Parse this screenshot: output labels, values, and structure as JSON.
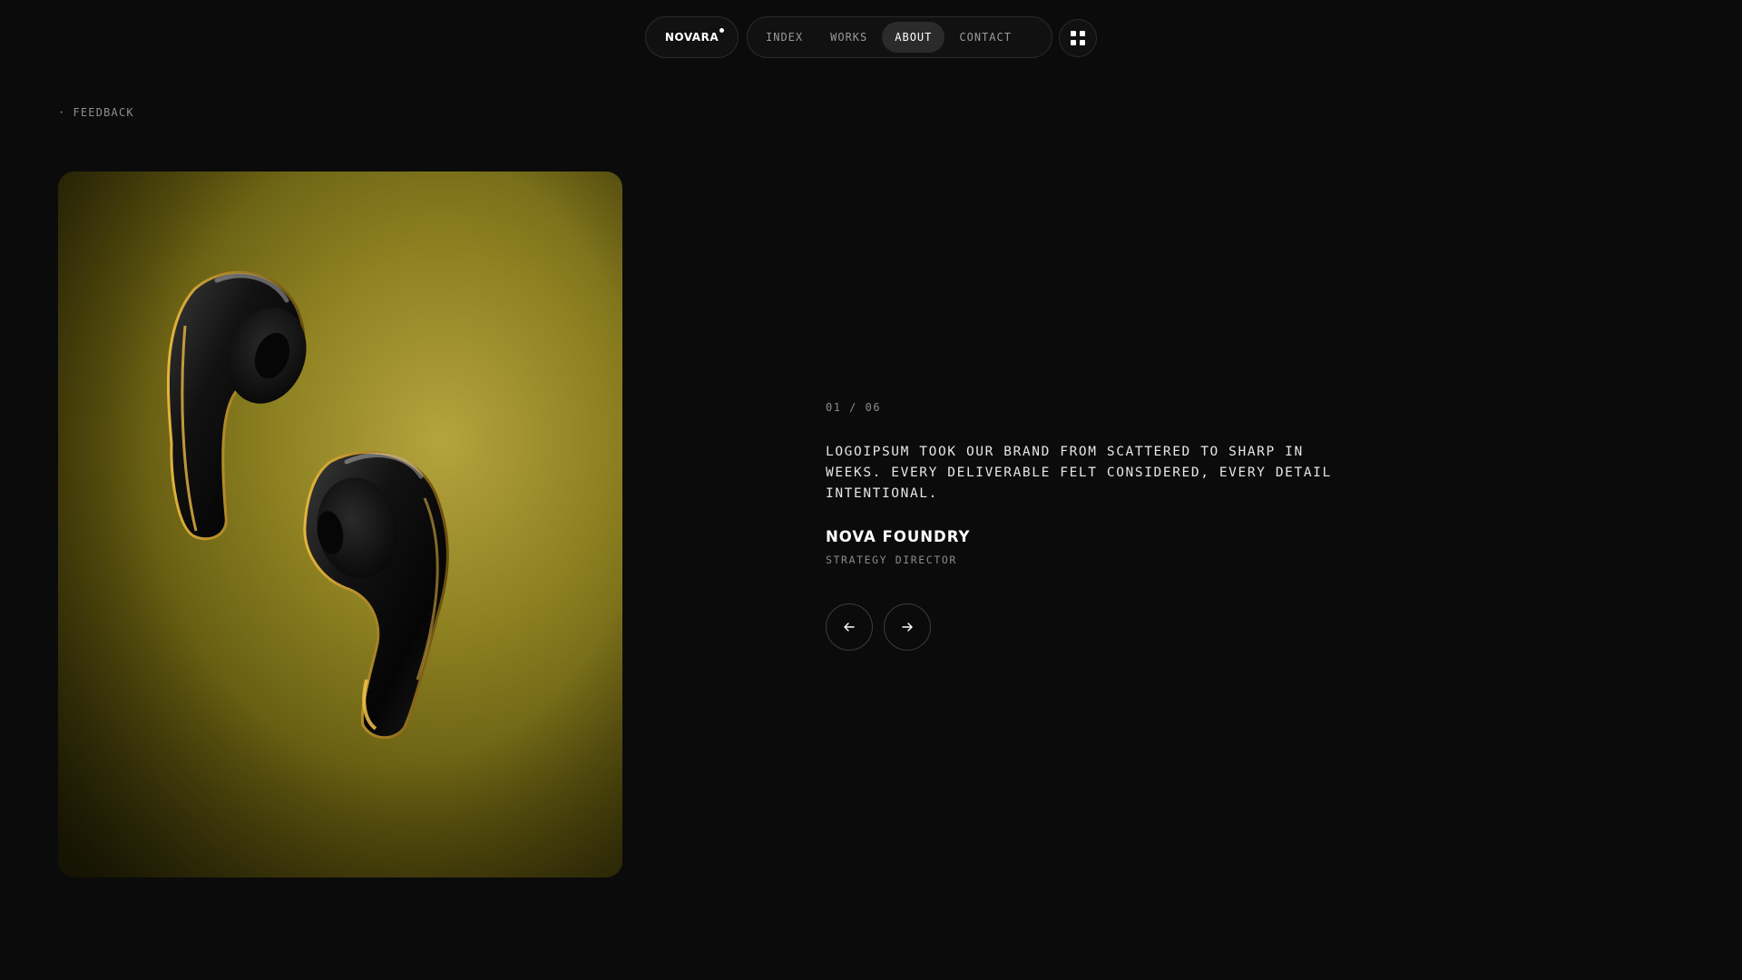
{
  "brand": {
    "logo_text": "NOVARA"
  },
  "nav": {
    "items": [
      {
        "label": "INDEX"
      },
      {
        "label": "WORKS"
      },
      {
        "label": "ABOUT"
      },
      {
        "label": "CONTACT"
      }
    ],
    "active": "ABOUT",
    "menu_icon": "grid-icon"
  },
  "section": {
    "bullet": "·",
    "label": "FEEDBACK"
  },
  "testimonial": {
    "counter": "01 / 06",
    "quote": "LOGOIPSUM TOOK OUR BRAND FROM SCATTERED TO SHARP IN WEEKS. EVERY DELIVERABLE FELT CONSIDERED, EVERY DETAIL INTENTIONAL.",
    "author": "NOVA FOUNDRY",
    "role": "STRATEGY DIRECTOR"
  },
  "controls": {
    "prev_icon": "arrow-left-icon",
    "next_icon": "arrow-right-icon"
  },
  "colors": {
    "background": "#0b0b0b",
    "image_accent": "#b5a43f",
    "text_primary": "#ffffff",
    "text_muted": "#8a8a8a"
  }
}
